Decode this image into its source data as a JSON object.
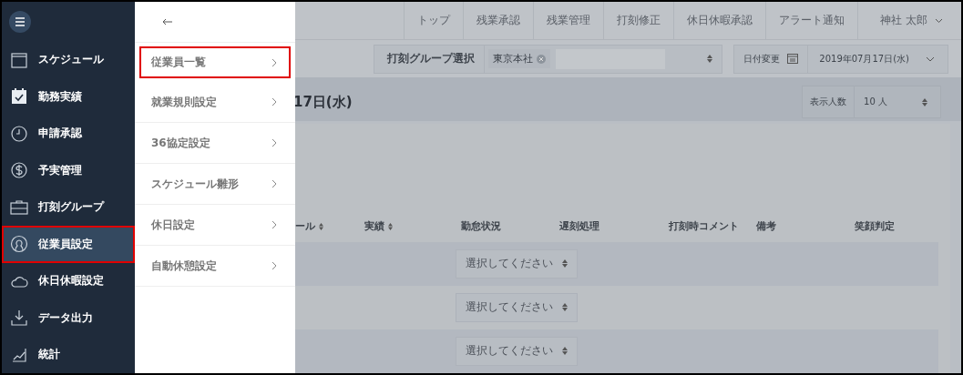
{
  "sidebar": {
    "items": [
      {
        "label": "スケジュール",
        "selected": false,
        "highlighted": false
      },
      {
        "label": "勤務実績",
        "selected": false,
        "highlighted": false
      },
      {
        "label": "申請承認",
        "selected": false,
        "highlighted": false
      },
      {
        "label": "予実管理",
        "selected": false,
        "highlighted": false
      },
      {
        "label": "打刻グループ",
        "selected": false,
        "highlighted": false
      },
      {
        "label": "従業員設定",
        "selected": true,
        "highlighted": true
      },
      {
        "label": "休日休暇設定",
        "selected": false,
        "highlighted": false
      },
      {
        "label": "データ出力",
        "selected": false,
        "highlighted": false
      },
      {
        "label": "統計",
        "selected": false,
        "highlighted": false
      }
    ]
  },
  "submenu": {
    "items": [
      {
        "label": "従業員一覧",
        "highlighted": true
      },
      {
        "label": "就業規則設定",
        "highlighted": false
      },
      {
        "label": "36協定設定",
        "highlighted": false
      },
      {
        "label": "スケジュール雛形",
        "highlighted": false
      },
      {
        "label": "休日設定",
        "highlighted": false
      },
      {
        "label": "自動休憩設定",
        "highlighted": false
      }
    ]
  },
  "nav": {
    "items": [
      "トップ",
      "残業承認",
      "残業管理",
      "打刻修正",
      "休日休暇承認",
      "アラート通知"
    ],
    "user": "神社 太郎"
  },
  "filters": {
    "group_label": "打刻グループ選択",
    "tags": [
      "東京本社"
    ],
    "date_label": "日付変更",
    "date": "2019年07月17日(水)"
  },
  "page_title": "17日(水)",
  "per_page": {
    "label": "表示人数",
    "value": "10 人"
  },
  "table": {
    "columns": [
      {
        "label": "ール",
        "sortable": true
      },
      {
        "label": "実績",
        "sortable": true
      },
      {
        "label": "勤怠状況",
        "sortable": false
      },
      {
        "label": "遅刻処理",
        "sortable": false
      },
      {
        "label": "打刻時コメント",
        "sortable": false
      },
      {
        "label": "備考",
        "sortable": false
      },
      {
        "label": "笑顔判定",
        "sortable": false
      }
    ],
    "rows": [
      {
        "status": "選択してください"
      },
      {
        "status": "選択してください"
      },
      {
        "status": "選択してください"
      }
    ]
  }
}
